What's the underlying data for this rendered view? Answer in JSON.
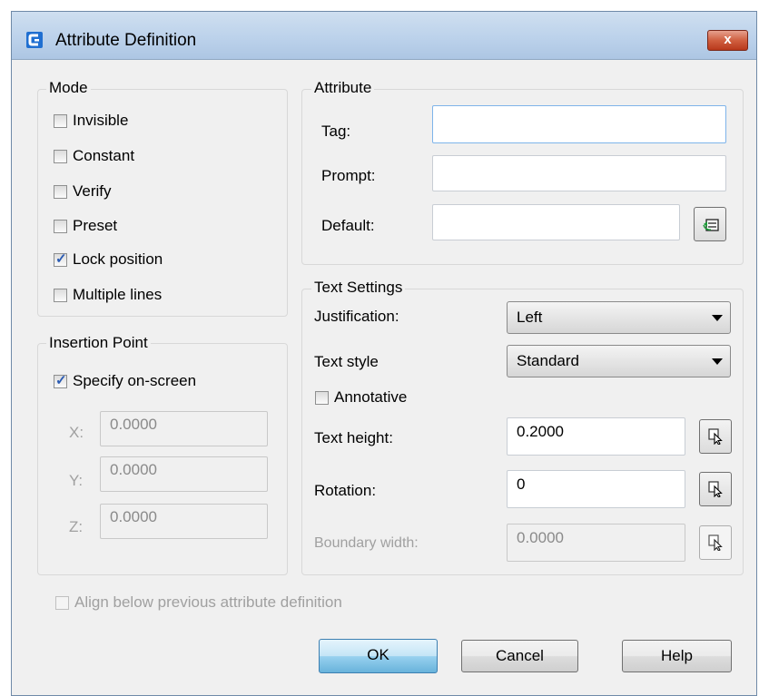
{
  "window": {
    "title": "Attribute Definition",
    "close_label": "x"
  },
  "colors": {
    "titlebar": "#bcd2eb",
    "close_button": "#c94a2c",
    "dialog_bg": "#f0f0f0",
    "focus_border": "#7eb4ea"
  },
  "icons": {
    "app": "app-logo-icon",
    "insert_field": "insert-field-icon",
    "pick_point": "pick-point-icon"
  },
  "mode": {
    "title": "Mode",
    "options": [
      {
        "label": "Invisible",
        "checked": false
      },
      {
        "label": "Constant",
        "checked": false
      },
      {
        "label": "Verify",
        "checked": false
      },
      {
        "label": "Preset",
        "checked": false
      },
      {
        "label": "Lock position",
        "checked": true
      },
      {
        "label": "Multiple lines",
        "checked": false
      }
    ]
  },
  "insertion": {
    "title": "Insertion Point",
    "specify_label": "Specify on-screen",
    "specify_checked": true,
    "x_label": "X:",
    "x_value": "0.0000",
    "y_label": "Y:",
    "y_value": "0.0000",
    "z_label": "Z:",
    "z_value": "0.0000"
  },
  "attribute": {
    "title": "Attribute",
    "tag_label": "Tag:",
    "tag_value": "",
    "prompt_label": "Prompt:",
    "prompt_value": "",
    "default_label": "Default:",
    "default_value": ""
  },
  "text_settings": {
    "title": "Text Settings",
    "justification_label": "Justification:",
    "justification_value": "Left",
    "text_style_label": "Text style",
    "text_style_value": "Standard",
    "annotative_label": "Annotative",
    "annotative_checked": false,
    "text_height_label": "Text height:",
    "text_height_value": "0.2000",
    "rotation_label": "Rotation:",
    "rotation_value": "0",
    "boundary_width_label": "Boundary width:",
    "boundary_width_value": "0.0000"
  },
  "align_below_label": "Align below previous attribute definition",
  "buttons": {
    "ok": "OK",
    "cancel": "Cancel",
    "help": "Help"
  }
}
